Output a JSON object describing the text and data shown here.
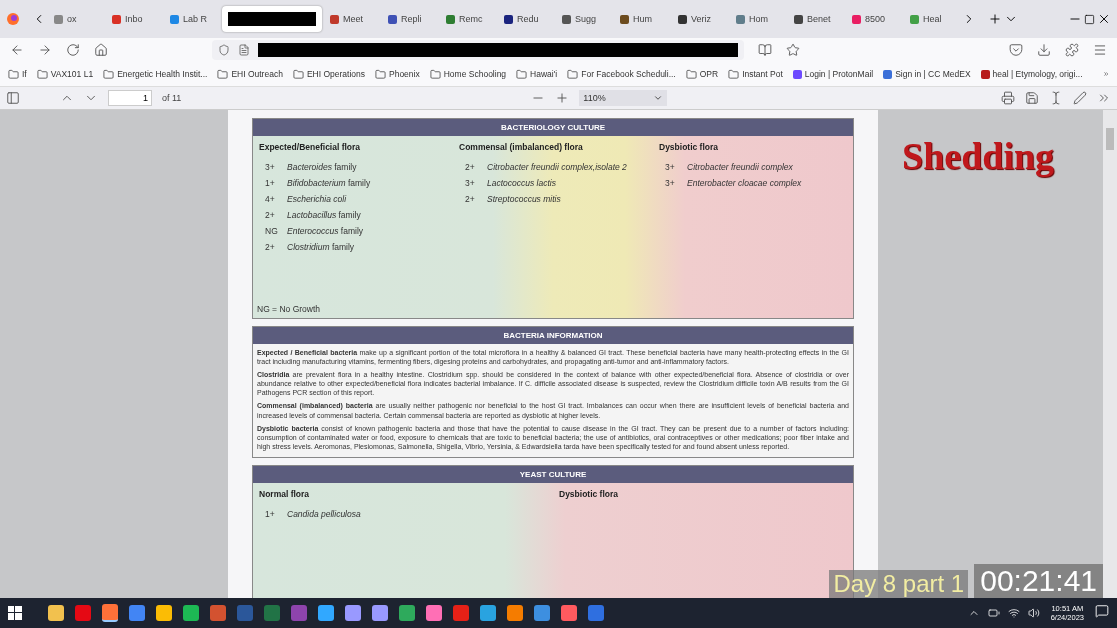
{
  "tabs": [
    {
      "label": "ox",
      "selected": false,
      "color": "#888888",
      "kind": "site"
    },
    {
      "label": "Inbo",
      "selected": false,
      "color": "#d93025",
      "kind": "site"
    },
    {
      "label": "Lab R",
      "selected": false,
      "color": "#1e88e5",
      "kind": "site"
    },
    {
      "kind": "redacted",
      "selected": true
    },
    {
      "label": "Meet",
      "selected": false,
      "color": "#c0392b",
      "kind": "site"
    },
    {
      "label": "Repli",
      "selected": false,
      "color": "#3f51b5",
      "kind": "site"
    },
    {
      "label": "Remc",
      "selected": false,
      "color": "#2e7d32",
      "kind": "site"
    },
    {
      "label": "Redu",
      "selected": false,
      "color": "#1a237e",
      "kind": "site"
    },
    {
      "label": "Sugg",
      "selected": false,
      "color": "#555555",
      "kind": "site"
    },
    {
      "label": "Hum",
      "selected": false,
      "color": "#6d4c1f",
      "kind": "site"
    },
    {
      "label": "Veriz",
      "selected": false,
      "color": "#333333",
      "kind": "site"
    },
    {
      "label": "Hom",
      "selected": false,
      "color": "#607d8b",
      "kind": "site"
    },
    {
      "label": "Benet",
      "selected": false,
      "color": "#444444",
      "kind": "site"
    },
    {
      "label": "8500",
      "selected": false,
      "color": "#e91e63",
      "kind": "site"
    },
    {
      "label": "Heal",
      "selected": false,
      "color": "#43a047",
      "kind": "site"
    }
  ],
  "bookmarks": [
    {
      "label": "If",
      "kind": "folder"
    },
    {
      "label": "VAX101 L1",
      "kind": "folder"
    },
    {
      "label": "Energetic Health Instit...",
      "kind": "folder"
    },
    {
      "label": "EHI Outreach",
      "kind": "folder"
    },
    {
      "label": "EHI Operations",
      "kind": "folder"
    },
    {
      "label": "Phoenix",
      "kind": "folder"
    },
    {
      "label": "Home Schooling",
      "kind": "folder"
    },
    {
      "label": "Hawai'i",
      "kind": "folder"
    },
    {
      "label": "For Facebook Scheduli...",
      "kind": "folder"
    },
    {
      "label": "OPR",
      "kind": "folder"
    },
    {
      "label": "Instant Pot",
      "kind": "folder"
    },
    {
      "label": "Login | ProtonMail",
      "kind": "site",
      "color": "#6d4aff"
    },
    {
      "label": "Sign in | CC MedEX",
      "kind": "site",
      "color": "#3b6fd8"
    },
    {
      "label": "heal | Etymology, origi...",
      "kind": "site",
      "color": "#b71c1c"
    }
  ],
  "pdf_toolbar": {
    "page": "1",
    "page_count": "of 11",
    "zoom": "110%"
  },
  "report": {
    "bacteriology": {
      "title": "BACTERIOLOGY CULTURE",
      "columns": [
        {
          "heading": "Expected/Beneficial flora",
          "items": [
            {
              "grade": "3+",
              "name": "Bacteroides",
              "suffix": "family"
            },
            {
              "grade": "1+",
              "name": "Bifidobacterium",
              "suffix": "family"
            },
            {
              "grade": "4+",
              "name": "Escherichia coli"
            },
            {
              "grade": "2+",
              "name": "Lactobacillus",
              "suffix": "family"
            },
            {
              "grade": "NG",
              "name": "Enterococcus",
              "suffix": "family"
            },
            {
              "grade": "2+",
              "name": "Clostridium",
              "suffix": "family"
            }
          ]
        },
        {
          "heading": "Commensal (imbalanced) flora",
          "items": [
            {
              "grade": "2+",
              "name": "Citrobacter freundii complex,isolate 2"
            },
            {
              "grade": "3+",
              "name": "Lactococcus lactis"
            },
            {
              "grade": "2+",
              "name": "Streptococcus mitis"
            }
          ]
        },
        {
          "heading": "Dysbiotic flora",
          "items": [
            {
              "grade": "3+",
              "name": "Citrobacter freundii complex"
            },
            {
              "grade": "3+",
              "name": "Enterobacter cloacae complex"
            }
          ]
        }
      ],
      "footnote": "NG = No Growth"
    },
    "information": {
      "title": "BACTERIA INFORMATION",
      "paragraphs": [
        "**Expected / Beneficial bacteria** make up a significant portion of the total microflora in a healthy & balanced GI tract. These beneficial bacteria have many health-protecting effects in the GI tract including manufacturing vitamins, fermenting fibers, digesing proteins and carbohydrates, and propagating anti-tumor and anti-inflammatory factors.",
        "**Clostridia** are prevalent flora in a healthy intestine. Clostridium spp. should be considered in the context of balance with other expected/beneficial flora. Absence of clostridia or over abundance relative to other expected/beneficial flora indicates bacterial imbalance. If C. difficile associated disease is suspected, review the Clostridium difficile toxin A/B results from the GI Pathogens PCR section of this report.",
        "**Commensal (imbalanced) bacteria** are usually neither pathogenic nor beneficial to the host GI tract. Imbalances can occur when there are insufficient levels of beneficial bacteria and increased levels of commensal bacteria. Certain commensal bacteria are reported as dysbiotic at higher levels.",
        "**Dysbiotic bacteria** consist of known pathogenic bacteria and those that have the potential to cause disease in the GI tract. They can be present due to a number of factors including: consumption of contaminated water or food, exposure to chemicals that are toxic to beneficial bacteria; the use of antibiotics, oral contraceptives or other medications; poor fiber intake and high stress levels. Aeromonas, Plesiomonas, Salmonella, Shigella, Vibrio, Yersinia, & Edwardsiella tarda have been specifically tested for and found absent unless reported."
      ]
    },
    "yeast": {
      "title": "YEAST CULTURE",
      "columns": [
        {
          "heading": "Normal flora",
          "items": [
            {
              "grade": "1+",
              "name": "Candida pelliculosa"
            }
          ]
        },
        {
          "heading": "Dysbiotic flora"
        }
      ]
    }
  },
  "overlay": {
    "caption": "Shedding",
    "episode": "Day 8 part 1",
    "timecode": "00:21:41"
  },
  "taskbar": {
    "apps": [
      {
        "color": "#f2c14e",
        "selected": false
      },
      {
        "color": "#e50914",
        "selected": false
      },
      {
        "color": "#ff7139",
        "selected": true
      },
      {
        "color": "#4285f4",
        "selected": false
      },
      {
        "color": "#fbbc05",
        "selected": false
      },
      {
        "color": "#1db954",
        "selected": false
      },
      {
        "color": "#d35230",
        "selected": false
      },
      {
        "color": "#2b579a",
        "selected": false
      },
      {
        "color": "#217346",
        "selected": false
      },
      {
        "color": "#8e44ad",
        "selected": false
      },
      {
        "color": "#31a8ff",
        "selected": false
      },
      {
        "color": "#9999ff",
        "selected": false
      },
      {
        "color": "#9999ff",
        "selected": false
      },
      {
        "color": "#2eaa5c",
        "selected": false
      },
      {
        "color": "#ff6fb5",
        "selected": false
      },
      {
        "color": "#e62117",
        "selected": false
      },
      {
        "color": "#29a3e0",
        "selected": false
      },
      {
        "color": "#f57c00",
        "selected": false
      },
      {
        "color": "#3d8fe0",
        "selected": false
      },
      {
        "color": "#ff5a5f",
        "selected": false
      },
      {
        "color": "#2f6fe0",
        "selected": false
      }
    ],
    "time": "10:51 AM",
    "date": "6/24/2023"
  }
}
